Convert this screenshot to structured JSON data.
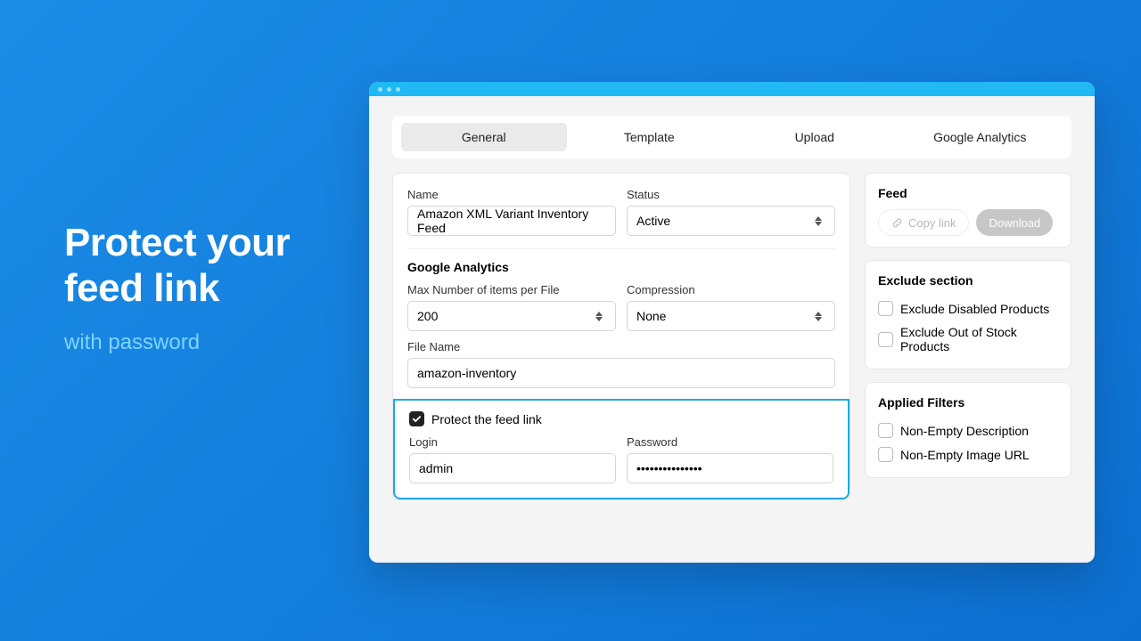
{
  "hero": {
    "title_line1": "Protect your",
    "title_line2": "feed link",
    "subtitle": "with password"
  },
  "tabs": [
    {
      "label": "General",
      "active": true
    },
    {
      "label": "Template",
      "active": false
    },
    {
      "label": "Upload",
      "active": false
    },
    {
      "label": "Google Analytics",
      "active": false
    }
  ],
  "form": {
    "name_label": "Name",
    "name_value": "Amazon XML Variant Inventory Feed",
    "status_label": "Status",
    "status_value": "Active",
    "ga_heading": "Google Analytics",
    "max_items_label": "Max Number of items per File",
    "max_items_value": "200",
    "compression_label": "Compression",
    "compression_value": "None",
    "filename_label": "File Name",
    "filename_value": "amazon-inventory",
    "protect_label": "Protect the feed link",
    "protect_checked": true,
    "login_label": "Login",
    "login_value": "admin",
    "password_label": "Password",
    "password_value": "•••••••••••••••"
  },
  "side": {
    "feed_heading": "Feed",
    "copy_link": "Copy link",
    "download": "Download",
    "exclude_heading": "Exclude section",
    "exclude_items": [
      {
        "label": "Exclude Disabled Products",
        "checked": false
      },
      {
        "label": "Exclude Out of Stock Products",
        "checked": false
      }
    ],
    "filters_heading": "Applied Filters",
    "filters_items": [
      {
        "label": "Non-Empty Description",
        "checked": false
      },
      {
        "label": "Non-Empty Image URL",
        "checked": false
      }
    ]
  }
}
